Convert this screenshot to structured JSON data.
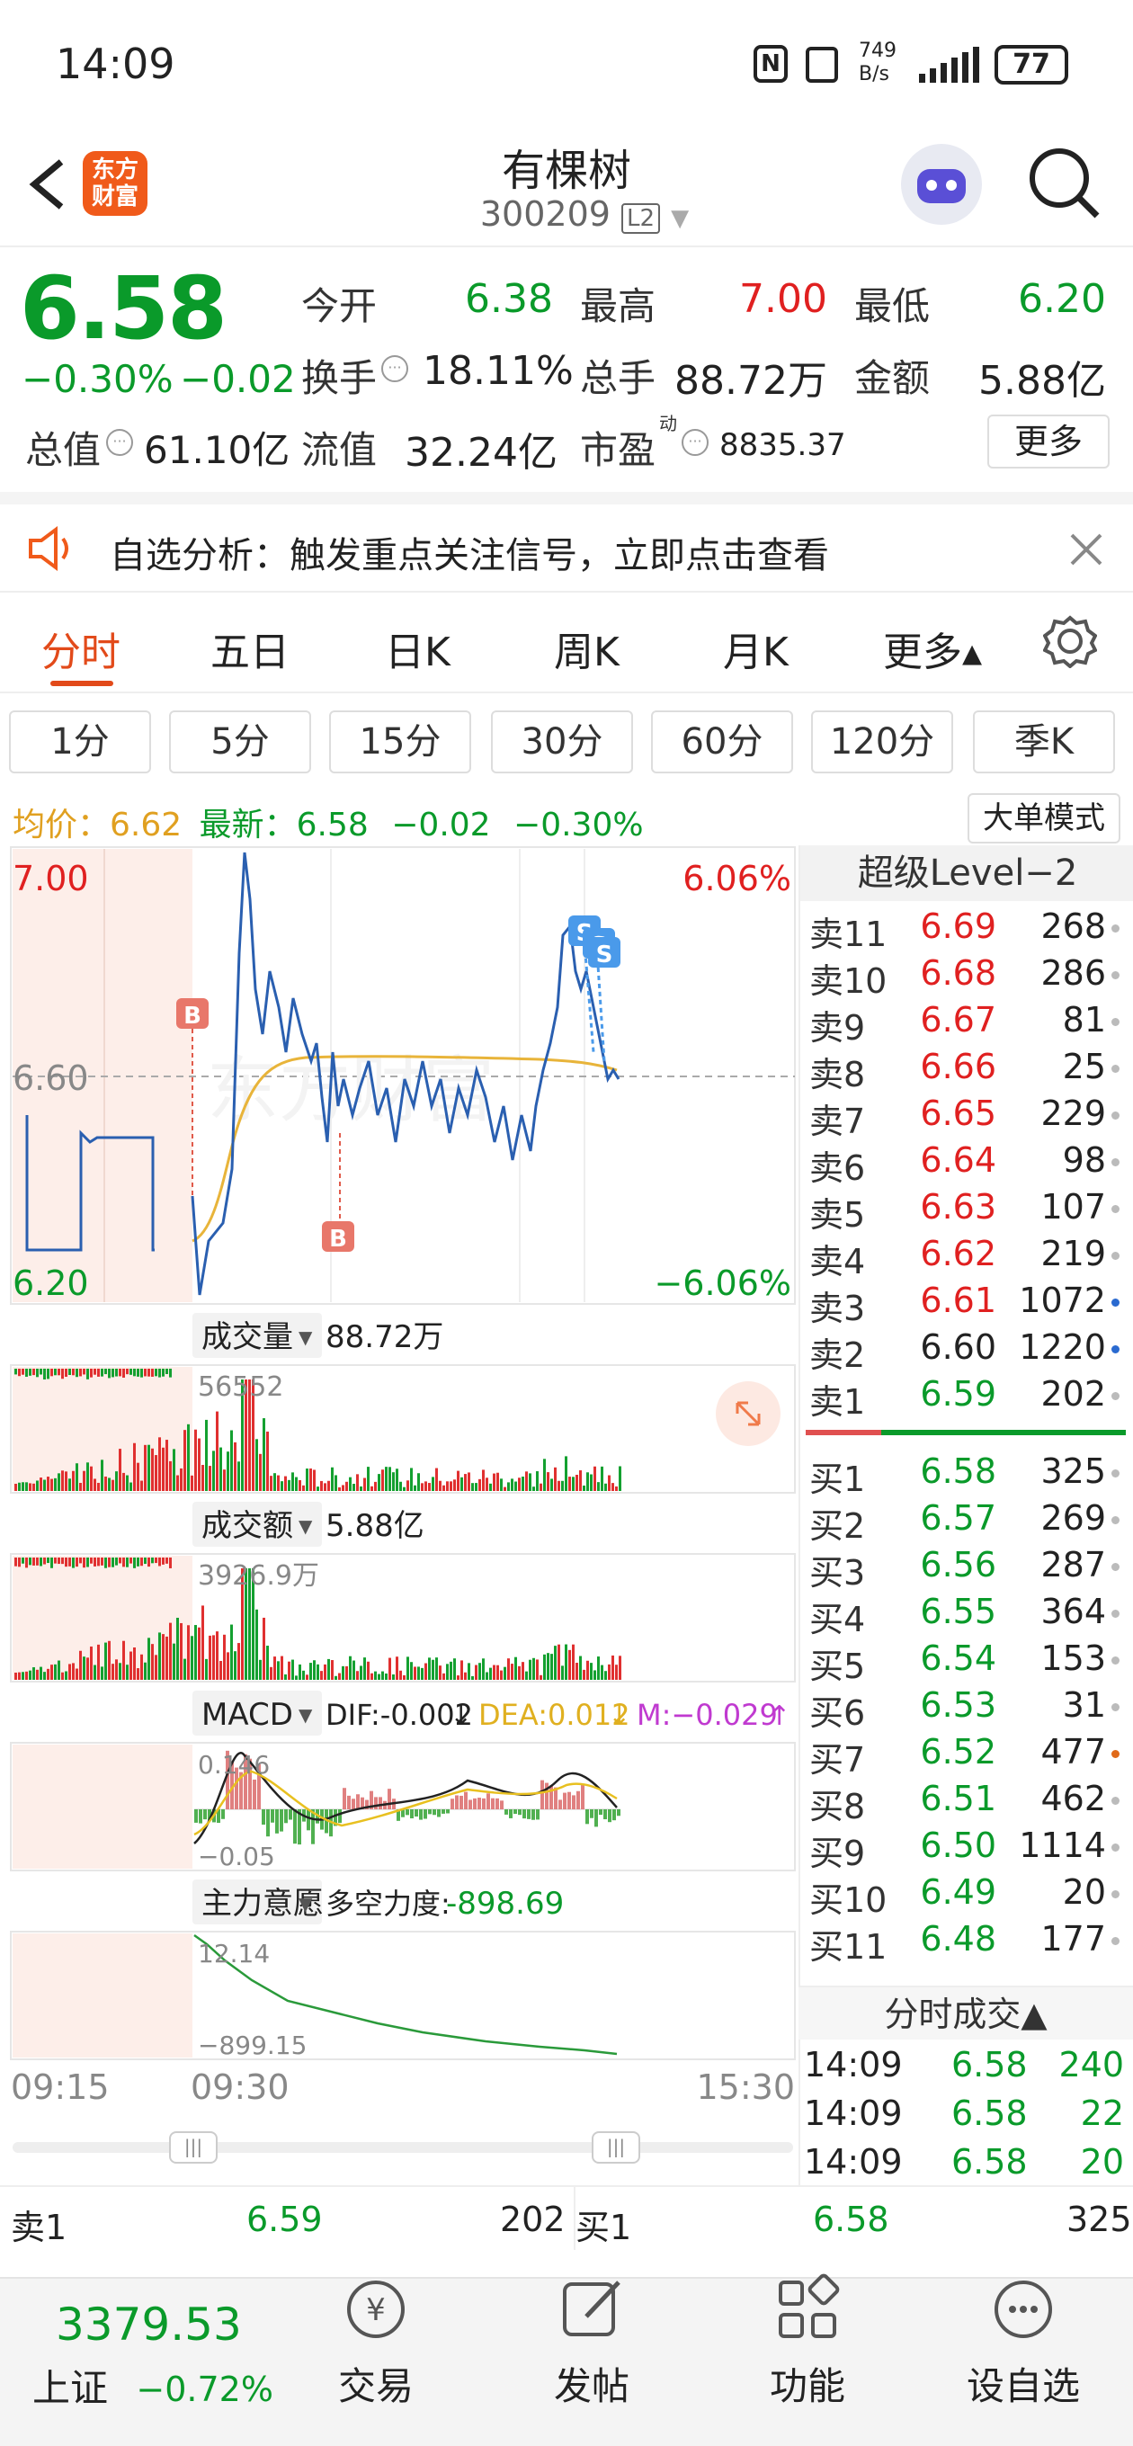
{
  "status_bar": {
    "time": "14:09",
    "net_speed_top": "749",
    "net_speed_bottom": "B/s",
    "battery": "77"
  },
  "header": {
    "brand_line1": "东方",
    "brand_line2": "财富",
    "title": "有棵树",
    "code": "300209",
    "level_badge": "L2"
  },
  "quote": {
    "price": "6.58",
    "change_pct": "−0.30%",
    "change": "−0.02",
    "total_value_label": "总值",
    "total_value": "61.10亿",
    "open_label": "今开",
    "open": "6.38",
    "high_label": "最高",
    "high": "7.00",
    "low_label": "最低",
    "low": "6.20",
    "turnover_label": "换手",
    "turnover": "18.11%",
    "volume_label": "总手",
    "volume": "88.72万",
    "amount_label": "金额",
    "amount": "5.88亿",
    "float_value_label": "流值",
    "float_value": "32.24亿",
    "pe_label": "市盈",
    "pe_sup": "动",
    "pe": "8835.37",
    "more": "更多"
  },
  "notice": {
    "text": "自选分析：触发重点关注信号，立即点击查看"
  },
  "tabs": [
    "分时",
    "五日",
    "日K",
    "周K",
    "月K",
    "更多▴"
  ],
  "periods": [
    "1分",
    "5分",
    "15分",
    "30分",
    "60分",
    "120分",
    "季K"
  ],
  "legend": {
    "avg_label": "均价：",
    "avg": "6.62",
    "latest_label": "最新：",
    "latest": "6.58",
    "latest_chg": "−0.02",
    "latest_pct": "−0.30%",
    "big_order": "大单模式"
  },
  "chart": {
    "y_high": "7.00",
    "y_mid": "6.60",
    "y_low": "6.20",
    "pct_high": "6.06%",
    "pct_low": "−6.06%",
    "watermark": "东方财富",
    "marker_b": "B",
    "marker_s": "S",
    "time_start": "09:15",
    "time_open": "09:30",
    "time_end": "15:30"
  },
  "volume_panel": {
    "label": "成交量",
    "value": "88.72万",
    "max": "56552"
  },
  "amount_panel": {
    "label": "成交额",
    "value": "5.88亿",
    "max": "3926.9万"
  },
  "macd_panel": {
    "label": "MACD",
    "dif": "DIF:-0.002",
    "dea": "DEA:0.012",
    "m": "M:−0.029",
    "top": "0.146",
    "bottom": "−0.05"
  },
  "main_panel": {
    "label": "主力意愿",
    "desc_label": "多空力度:",
    "desc_value": "-898.69",
    "top": "12.14",
    "bottom": "−899.15"
  },
  "level2": {
    "title": "超级Level−2",
    "asks": [
      {
        "l": "卖11",
        "p": "6.69",
        "v": "268"
      },
      {
        "l": "卖10",
        "p": "6.68",
        "v": "286"
      },
      {
        "l": "卖9",
        "p": "6.67",
        "v": "81"
      },
      {
        "l": "卖8",
        "p": "6.66",
        "v": "25"
      },
      {
        "l": "卖7",
        "p": "6.65",
        "v": "229"
      },
      {
        "l": "卖6",
        "p": "6.64",
        "v": "98"
      },
      {
        "l": "卖5",
        "p": "6.63",
        "v": "107"
      },
      {
        "l": "卖4",
        "p": "6.62",
        "v": "219"
      },
      {
        "l": "卖3",
        "p": "6.61",
        "v": "1072"
      },
      {
        "l": "卖2",
        "p": "6.60",
        "v": "1220"
      },
      {
        "l": "卖1",
        "p": "6.59",
        "v": "202"
      }
    ],
    "bids": [
      {
        "l": "买1",
        "p": "6.58",
        "v": "325"
      },
      {
        "l": "买2",
        "p": "6.57",
        "v": "269"
      },
      {
        "l": "买3",
        "p": "6.56",
        "v": "287"
      },
      {
        "l": "买4",
        "p": "6.55",
        "v": "364"
      },
      {
        "l": "买5",
        "p": "6.54",
        "v": "153"
      },
      {
        "l": "买6",
        "p": "6.53",
        "v": "31"
      },
      {
        "l": "买7",
        "p": "6.52",
        "v": "477"
      },
      {
        "l": "买8",
        "p": "6.51",
        "v": "462"
      },
      {
        "l": "买9",
        "p": "6.50",
        "v": "1114"
      },
      {
        "l": "买10",
        "p": "6.49",
        "v": "20"
      },
      {
        "l": "买11",
        "p": "6.48",
        "v": "177"
      }
    ],
    "ticks_title": "分时成交▲",
    "ticks": [
      {
        "t": "14:09",
        "p": "6.58",
        "v": "240"
      },
      {
        "t": "14:09",
        "p": "6.58",
        "v": "22"
      },
      {
        "t": "14:09",
        "p": "6.58",
        "v": "20"
      }
    ]
  },
  "bottom_quote": {
    "sell_label": "卖1",
    "sell_price": "6.59",
    "sell_vol": "202",
    "buy_label": "买1",
    "buy_price": "6.58",
    "buy_vol": "325"
  },
  "bottom_nav": {
    "index_value": "3379.53",
    "index_name": "上证",
    "index_chg": "−0.72%",
    "trade": "交易",
    "post": "发帖",
    "func": "功能",
    "watch": "设自选"
  }
}
